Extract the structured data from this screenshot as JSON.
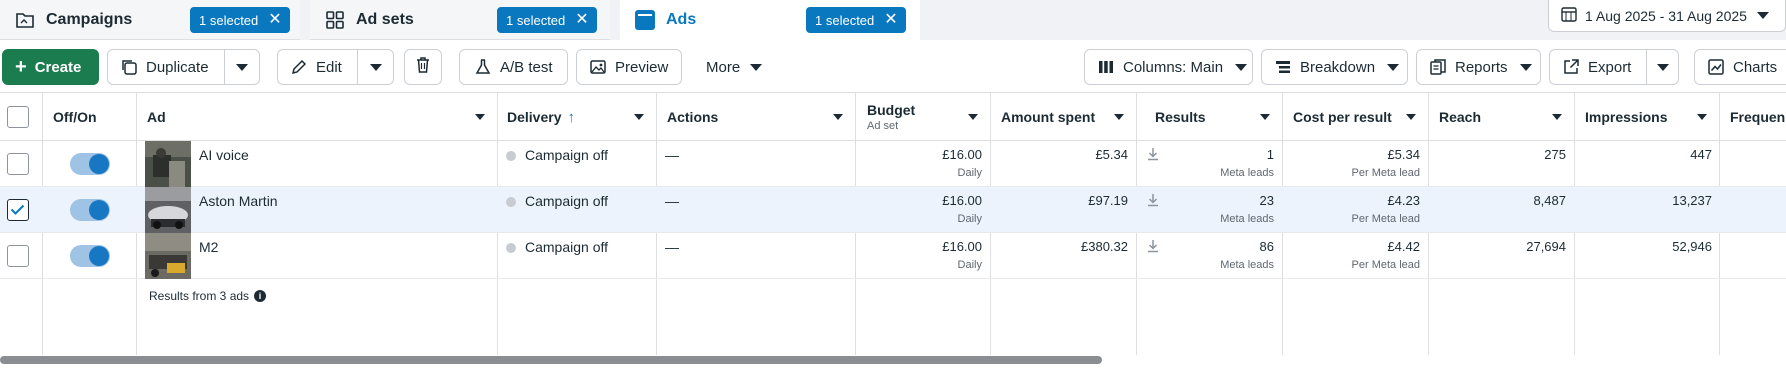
{
  "tabs": [
    {
      "label": "Campaigns",
      "selected_label": "1 selected",
      "icon": "folder-icon"
    },
    {
      "label": "Ad sets",
      "selected_label": "1 selected",
      "icon": "grid-icon"
    },
    {
      "label": "Ads",
      "selected_label": "1 selected",
      "icon": "ad-icon"
    }
  ],
  "date_range": "1 Aug 2025 - 31 Aug 2025",
  "toolbar": {
    "create": "Create",
    "duplicate": "Duplicate",
    "edit": "Edit",
    "ab_test": "A/B test",
    "preview": "Preview",
    "more": "More",
    "columns": "Columns: Main",
    "breakdown": "Breakdown",
    "reports": "Reports",
    "export": "Export",
    "charts": "Charts"
  },
  "columns": {
    "off_on": "Off/On",
    "ad": "Ad",
    "delivery": "Delivery",
    "actions": "Actions",
    "budget": "Budget",
    "budget_sub": "Ad set",
    "amount_spent": "Amount spent",
    "results": "Results",
    "cost_per_result": "Cost per result",
    "reach": "Reach",
    "impressions": "Impressions",
    "frequency": "Frequen"
  },
  "rows": [
    {
      "name": "AI voice",
      "selected": false,
      "delivery": "Campaign off",
      "actions": "—",
      "budget": "£16.00",
      "budget_period": "Daily",
      "amount_spent": "£5.34",
      "results": "1",
      "results_type": "Meta leads",
      "cost_per_result": "£5.34",
      "cost_per_result_type": "Per Meta lead",
      "reach": "275",
      "impressions": "447"
    },
    {
      "name": "Aston Martin",
      "selected": true,
      "delivery": "Campaign off",
      "actions": "—",
      "budget": "£16.00",
      "budget_period": "Daily",
      "amount_spent": "£97.19",
      "results": "23",
      "results_type": "Meta leads",
      "cost_per_result": "£4.23",
      "cost_per_result_type": "Per Meta lead",
      "reach": "8,487",
      "impressions": "13,237"
    },
    {
      "name": "M2",
      "selected": false,
      "delivery": "Campaign off",
      "actions": "—",
      "budget": "£16.00",
      "budget_period": "Daily",
      "amount_spent": "£380.32",
      "results": "86",
      "results_type": "Meta leads",
      "cost_per_result": "£4.42",
      "cost_per_result_type": "Per Meta lead",
      "reach": "27,694",
      "impressions": "52,946"
    }
  ],
  "footer": "Results from 3 ads",
  "colors": {
    "accent": "#0a78be",
    "create": "#1b7c4f",
    "toggle_on": "#1877c2"
  }
}
